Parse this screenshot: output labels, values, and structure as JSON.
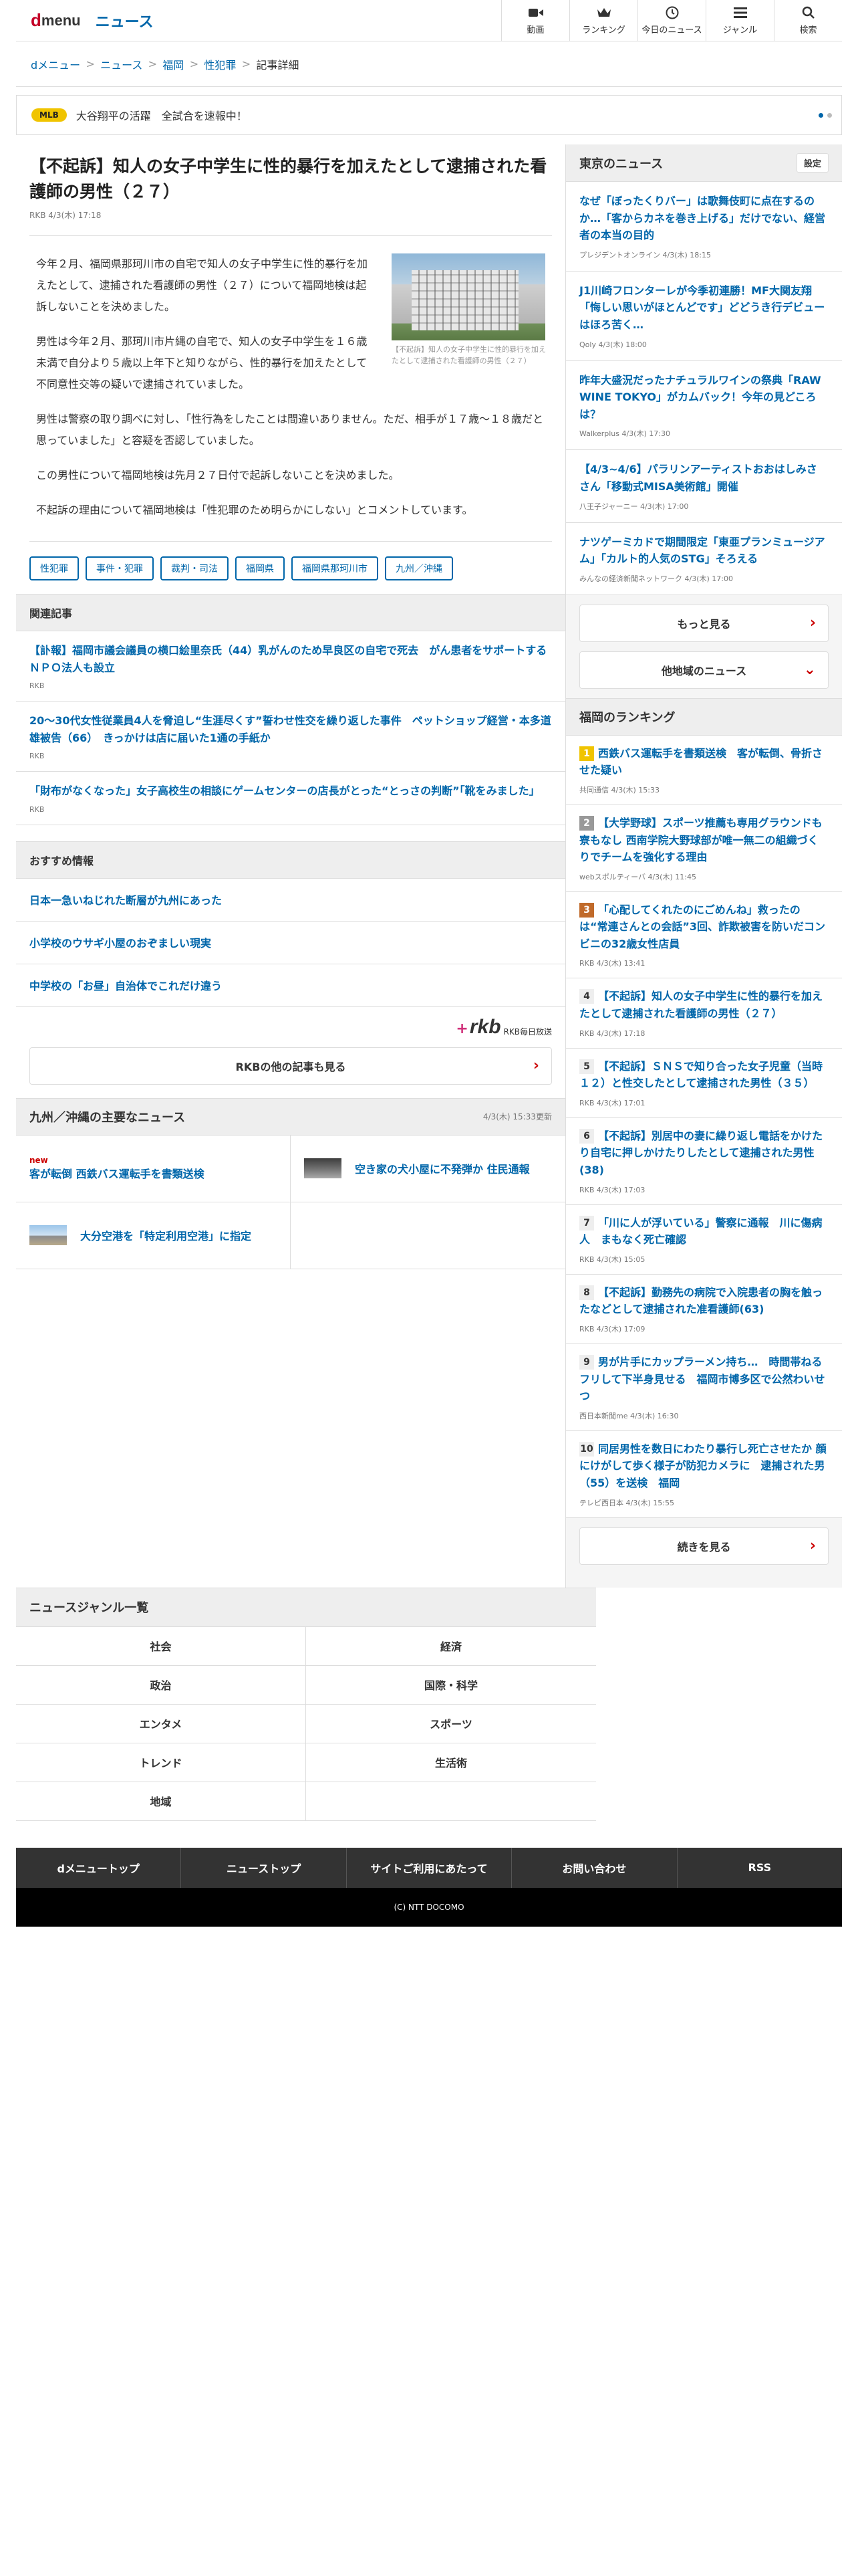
{
  "header": {
    "logo_d": "d",
    "logo_menu": "menu",
    "news_label": "ニュース",
    "nav": [
      {
        "label": "動画",
        "icon": "video-icon"
      },
      {
        "label": "ランキング",
        "icon": "crown-icon"
      },
      {
        "label": "今日のニュース",
        "icon": "clock-icon"
      },
      {
        "label": "ジャンル",
        "icon": "list-icon"
      },
      {
        "label": "検索",
        "icon": "search-icon"
      }
    ]
  },
  "breadcrumb": [
    "dメニュー",
    "ニュース",
    "福岡",
    "性犯罪",
    "記事詳細"
  ],
  "ticker": {
    "tag": "MLB",
    "text": "大谷翔平の活躍　全試合を速報中！"
  },
  "article": {
    "title": "【不起訴】知人の女子中学生に性的暴行を加えたとして逮捕された看護師の男性（２７）",
    "source": "RKB 4/3(木) 17:18",
    "photo_caption": "【不起訴】知人の女子中学生に性的暴行を加えたとして逮捕された看護師の男性（２７）",
    "paragraphs": [
      "今年２月、福岡県那珂川市の自宅で知人の女子中学生に性的暴行を加えたとして、逮捕された看護師の男性（２７）について福岡地検は起訴しないことを決めました。",
      "男性は今年２月、那珂川市片縄の自宅で、知人の女子中学生を１６歳未満で自分より５歳以上年下と知りながら、性的暴行を加えたとして不同意性交等の疑いで逮捕されていました。",
      "男性は警察の取り調べに対し、「性行為をしたことは間違いありません。ただ、相手が１７歳～１８歳だと思っていました」と容疑を否認していました。",
      "この男性について福岡地検は先月２７日付で起訴しないことを決めました。",
      "不起訴の理由について福岡地検は「性犯罪のため明らかにしない」とコメントしています。"
    ],
    "tags": [
      "性犯罪",
      "事件・犯罪",
      "裁判・司法",
      "福岡県",
      "福岡県那珂川市",
      "九州／沖縄"
    ]
  },
  "related": {
    "heading": "関連記事",
    "items": [
      {
        "title": "【訃報】福岡市議会議員の横口絵里奈氏（44）乳がんのため早良区の自宅で死去　がん患者をサポートするＮＰＯ法人も設立",
        "source": "RKB"
      },
      {
        "title": "20～30代女性従業員4人を脅迫し“生涯尽くす”誓わせ性交を繰り返した事件　ペットショップ経営・本多道雄被告（66）　きっかけは店に届いた1通の手紙か",
        "source": "RKB"
      },
      {
        "title": "「財布がなくなった」女子高校生の相談にゲームセンターの店長がとった“とっさの判断”「靴をみました」",
        "source": "RKB"
      }
    ]
  },
  "recommend": {
    "heading": "おすすめ情報",
    "items": [
      "日本一急いねじれた断層が九州にあった",
      "小学校のウサギ小屋のおぞましい現実",
      "中学校の「お昼」自治体でこれだけ違う"
    ]
  },
  "rkb": {
    "mark": "rkb",
    "name": "RKB毎日放送",
    "more": "RKBの他の記事も見る"
  },
  "kyushu": {
    "heading": "九州／沖縄の主要なニュース",
    "time": "4/3(木) 15:33更新",
    "items": [
      {
        "new": "new",
        "title": "客が転倒 西鉄バス運転手を書類送検"
      },
      {
        "new": "",
        "title": "空き家の犬小屋に不発弾か 住民通報"
      },
      {
        "new": "",
        "title": "大分空港を「特定利用空港」に指定"
      },
      {
        "new": "",
        "title": ""
      }
    ]
  },
  "tokyo": {
    "heading": "東京のニュース",
    "settings": "設定",
    "items": [
      {
        "title": "なぜ「ぼったくりバー」は歌舞伎町に点在するのか…「客からカネを巻き上げる」だけでない、経営者の本当の目的",
        "source": "プレジデントオンライン 4/3(木) 18:15"
      },
      {
        "title": "J1川崎フロンターレが今季初連勝！MF大関友翔「悔しい思いがほとんどです」どどうき行デビューはほろ苦く…",
        "source": "Qoly 4/3(木) 18:00"
      },
      {
        "title": "昨年大盛況だったナチュラルワインの祭典「RAW WINE TOKYO」がカムバック！今年の見どころは？",
        "source": "Walkerplus 4/3(木) 17:30"
      },
      {
        "title": "【4/3~4/6】パラリンアーティストおおはしみさ さん「移動式MISA美術館」開催",
        "source": "八王子ジャーニー 4/3(木) 17:00"
      },
      {
        "title": "ナツゲーミカドで期間限定「東亜プランミュージアム」「カルト的人気のSTG」そろえる",
        "source": "みんなの経済新聞ネットワーク 4/3(木) 17:00"
      }
    ],
    "more": "もっと見る",
    "other": "他地域のニュース"
  },
  "ranking": {
    "heading": "福岡のランキング",
    "items": [
      {
        "n": "1",
        "title": "西鉄バス運転手を書類送検　客が転倒、骨折させた疑い",
        "source": "共同通信 4/3(木) 15:33"
      },
      {
        "n": "2",
        "title": "【大学野球】スポーツ推薦も専用グラウンドも寮もなし 西南学院大野球部が唯一無二の組織づくりでチームを強化する理由",
        "source": "webスポルティーバ 4/3(木) 11:45"
      },
      {
        "n": "3",
        "title": "「心配してくれたのにごめんね」救ったのは“常連さんとの会話”3回、詐欺被害を防いだコンビニの32歳女性店員",
        "source": "RKB 4/3(木) 13:41"
      },
      {
        "n": "4",
        "title": "【不起訴】知人の女子中学生に性的暴行を加えたとして逮捕された看護師の男性（２７）",
        "source": "RKB 4/3(木) 17:18"
      },
      {
        "n": "5",
        "title": "【不起訴】ＳＮＳで知り合った女子児童（当時１２）と性交したとして逮捕された男性（３５）",
        "source": "RKB 4/3(木) 17:01"
      },
      {
        "n": "6",
        "title": "【不起訴】別居中の妻に繰り返し電話をかけたり自宅に押しかけたりしたとして逮捕された男性(38)",
        "source": "RKB 4/3(木) 17:03"
      },
      {
        "n": "7",
        "title": "「川に人が浮いている」警察に通報　川に傷病人　まもなく死亡確認",
        "source": "RKB 4/3(木) 15:05"
      },
      {
        "n": "8",
        "title": "【不起訴】勤務先の病院で入院患者の胸を触ったなどとして逮捕された准看護師(63)",
        "source": "RKB 4/3(木) 17:09"
      },
      {
        "n": "9",
        "title": "男が片手にカップラーメン持ち…　時間帯ねるフリして下半身見せる　福岡市博多区で公然わいせつ",
        "source": "西日本新聞me 4/3(木) 16:30"
      },
      {
        "n": "10",
        "title": "同居男性を数日にわたり暴行し死亡させたか 顔にけがして歩く様子が防犯カメラに　逮捕された男（55）を送検　福岡",
        "source": "テレビ西日本 4/3(木) 15:55"
      }
    ],
    "more": "続きを見る"
  },
  "genre": {
    "heading": "ニュースジャンル一覧",
    "items": [
      "社会",
      "経済",
      "政治",
      "国際・科学",
      "エンタメ",
      "スポーツ",
      "トレンド",
      "生活術",
      "地域",
      ""
    ]
  },
  "footer": {
    "nav": [
      "dメニュートップ",
      "ニューストップ",
      "サイトご利用にあたって",
      "お問い合わせ",
      "RSS"
    ],
    "copyright": "(C) NTT DOCOMO"
  },
  "colors": {
    "accent": "#0066aa",
    "brand": "#c40028",
    "mlb_tag": "#f0c400",
    "footer": "#333333"
  }
}
